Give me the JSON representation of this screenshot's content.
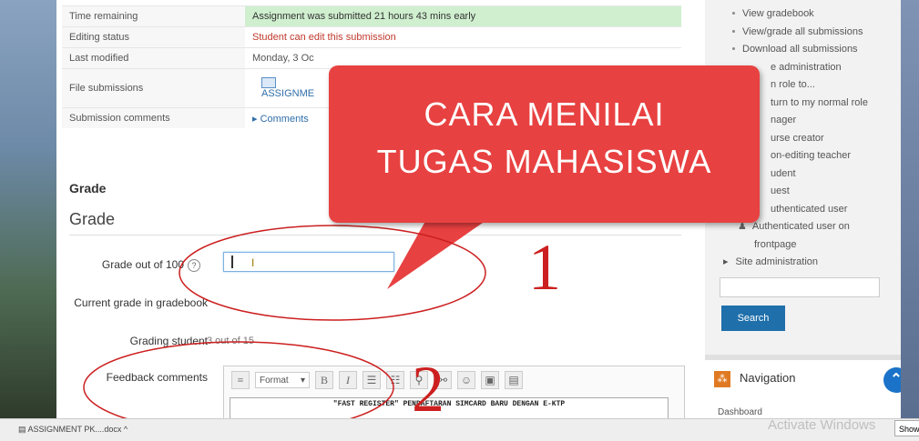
{
  "status_table": [
    {
      "label": "Time remaining",
      "value": "Assignment was submitted 21 hours 43 mins early"
    },
    {
      "label": "Editing status",
      "value": "Student can edit this submission"
    },
    {
      "label": "Last modified",
      "value": "Monday, 3 Oc"
    },
    {
      "label": "File submissions",
      "value": "ASSIGNME"
    },
    {
      "label": "Submission comments",
      "value": "Comments"
    }
  ],
  "grade": {
    "heading": "Grade",
    "subheading": "Grade",
    "grade_label": "Grade out of 100",
    "help_symbol": "?",
    "input_value": "",
    "cursor_glyph": "I",
    "current_grade_label": "Current grade in gradebook",
    "grading_student_label": "Grading student",
    "grading_student_value": "3 out of 15",
    "feedback_label": "Feedback comments"
  },
  "editor": {
    "format_label": "Format",
    "bold": "B",
    "italic": "I",
    "content": "\"FAST REGISTER\" PENDAFTARAN SIMCARD BARU DENGAN E-KTP"
  },
  "sidebar": {
    "items": [
      {
        "text": "View gradebook",
        "bullet": true
      },
      {
        "text": "View/grade all submissions",
        "bullet": true
      },
      {
        "text": "Download all submissions",
        "bullet": true
      },
      {
        "text": "e administration",
        "bullet": false
      },
      {
        "text": "n role to...",
        "bullet": false
      },
      {
        "text": "turn to my normal role",
        "bullet": false
      },
      {
        "text": "nager",
        "bullet": false
      },
      {
        "text": "urse creator",
        "bullet": false
      },
      {
        "text": "on-editing teacher",
        "bullet": false
      },
      {
        "text": "udent",
        "bullet": false
      },
      {
        "text": "uest",
        "bullet": false
      },
      {
        "text": "uthenticated user",
        "bullet": false
      },
      {
        "text": "Authenticated user on",
        "bullet": false
      },
      {
        "text": "frontpage",
        "bullet": false
      },
      {
        "text": "Site administration",
        "bullet": false
      }
    ],
    "search_button": "Search",
    "navigation_title": "Navigation",
    "dashboard": "Dashboard"
  },
  "overlay": {
    "line1": "CARA MENILAI",
    "line2": "TUGAS MAHASISWA",
    "number1": "1",
    "number2": "2"
  },
  "taskbar": {
    "item": "ASSIGNMENT PK....docx",
    "activate": "Activate Windows",
    "show": "Show"
  },
  "colors": {
    "accent_red": "#e84141",
    "annotation_red": "#cc1f1f",
    "link_blue": "#2f6ea8",
    "button_blue": "#1f6fab",
    "success_green": "#cfefcf"
  }
}
